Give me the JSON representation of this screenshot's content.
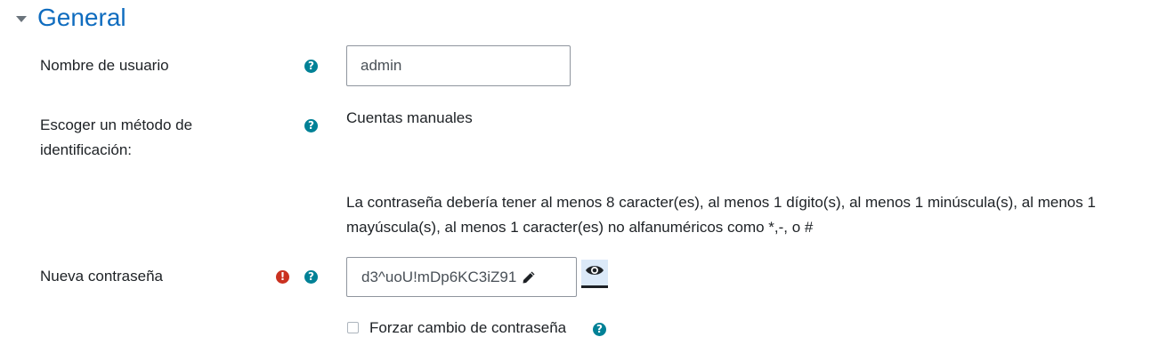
{
  "section": {
    "title": "General"
  },
  "fields": {
    "username": {
      "label": "Nombre de usuario",
      "value": "admin"
    },
    "auth": {
      "label_line1": "Escoger un método de",
      "label_line2": "identificación:",
      "value": "Cuentas manuales"
    },
    "password_rules": {
      "line1": "La contraseña debería tener al menos 8 caracter(es), al menos 1 dígito(s), al menos 1 minúscula(s), al menos 1",
      "line2": "mayúscula(s), al menos 1 caracter(es) no alfanuméricos como *,-, o #"
    },
    "new_password": {
      "label": "Nueva contraseña",
      "value": "d3^uoU!mDp6KC3iZ91"
    },
    "force_change": {
      "label": "Forzar cambio de contraseña",
      "checked": false
    }
  },
  "icons": {
    "help": "question-circle-icon",
    "error": "exclamation-circle-icon",
    "edit": "pencil-icon",
    "reveal": "eye-icon",
    "collapse": "caret-down-icon"
  },
  "colors": {
    "link_blue": "#0f6cbf",
    "help_teal": "#008196",
    "error_red": "#ca3120"
  }
}
